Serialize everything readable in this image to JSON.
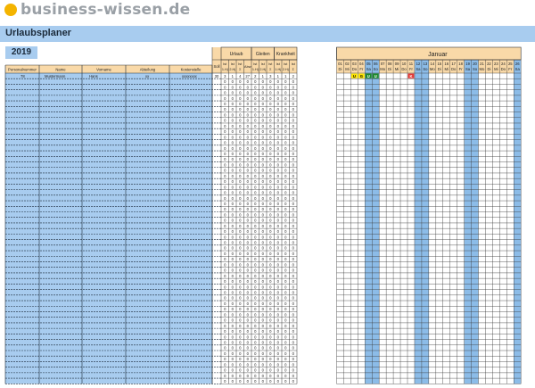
{
  "header": {
    "site_name": "business-wissen.de"
  },
  "sheet": {
    "title": "Urlaubsplaner",
    "year": "2019"
  },
  "groups": {
    "urlaub": "Urlaub",
    "gleiten": "Gleiten",
    "krankheit": "Krankheit",
    "month": "Januar"
  },
  "columns": {
    "personalnummer": "Personalnummer",
    "name": "Name",
    "vorname": "Vorname",
    "abteilung": "Abteilung",
    "kostenstelle": "Kostenstelle",
    "soll": "Soll",
    "sub": [
      [
        "Ist",
        "1.Hj"
      ],
      [
        "Ist",
        "2.Hj"
      ],
      [
        "Ist",
        "Σ"
      ],
      [
        "Abw",
        ""
      ],
      [
        "Ist",
        "1.Hj"
      ],
      [
        "Ist",
        "2.Hj"
      ],
      [
        "Ist",
        "Σ"
      ],
      [
        "Ist",
        "1.Hj"
      ],
      [
        "Ist",
        "2.Hj"
      ],
      [
        "Ist",
        "Σ"
      ]
    ]
  },
  "days": {
    "numbers": [
      "01",
      "02",
      "03",
      "04",
      "05",
      "06",
      "07",
      "08",
      "09",
      "10",
      "11",
      "12",
      "13",
      "14",
      "15",
      "16",
      "17",
      "18",
      "19",
      "20",
      "21",
      "22",
      "23",
      "24",
      "25",
      "26"
    ],
    "weekdays": [
      "Di",
      "Mi",
      "Do",
      "Fr",
      "Sa",
      "So",
      "Mo",
      "Di",
      "Mi",
      "Do",
      "Fr",
      "Sa",
      "So",
      "Mo",
      "Di",
      "Mi",
      "Do",
      "Fr",
      "Sa",
      "So",
      "Mo",
      "Di",
      "Mi",
      "Do",
      "Fr",
      "Sa"
    ],
    "weekend_indices": [
      4,
      5,
      11,
      12,
      18,
      19,
      25
    ]
  },
  "first_row": {
    "personalnummer": "78",
    "name": "Mustermann",
    "vorname": "Hans",
    "abteilung": "xx",
    "kostenstelle": "xxxxxxxx",
    "soll": "30",
    "values": [
      "3",
      "1",
      "4",
      "27",
      "2",
      "1",
      "3",
      "1",
      "1",
      "2"
    ]
  },
  "empty_row_value": "0",
  "marks": [
    {
      "day_index": 2,
      "code": "U",
      "color": "#ffe500",
      "text_color": "#000000"
    },
    {
      "day_index": 3,
      "code": "G",
      "color": "#ffe500",
      "text_color": "#000000"
    },
    {
      "day_index": 4,
      "code": "U",
      "color": "#1f8a2e",
      "text_color": "#ffffff"
    },
    {
      "day_index": 5,
      "code": "U",
      "color": "#1f8a2e",
      "text_color": "#ffffff"
    },
    {
      "day_index": 10,
      "code": "K",
      "color": "#e53935",
      "text_color": "#ffffff"
    }
  ],
  "colors": {
    "title_blue": "#a8ccef",
    "header_orange": "#f9d9a8",
    "row_blue": "#a8ccef",
    "weekend_blue": "#8cbce8",
    "grid_line": "#333333"
  }
}
